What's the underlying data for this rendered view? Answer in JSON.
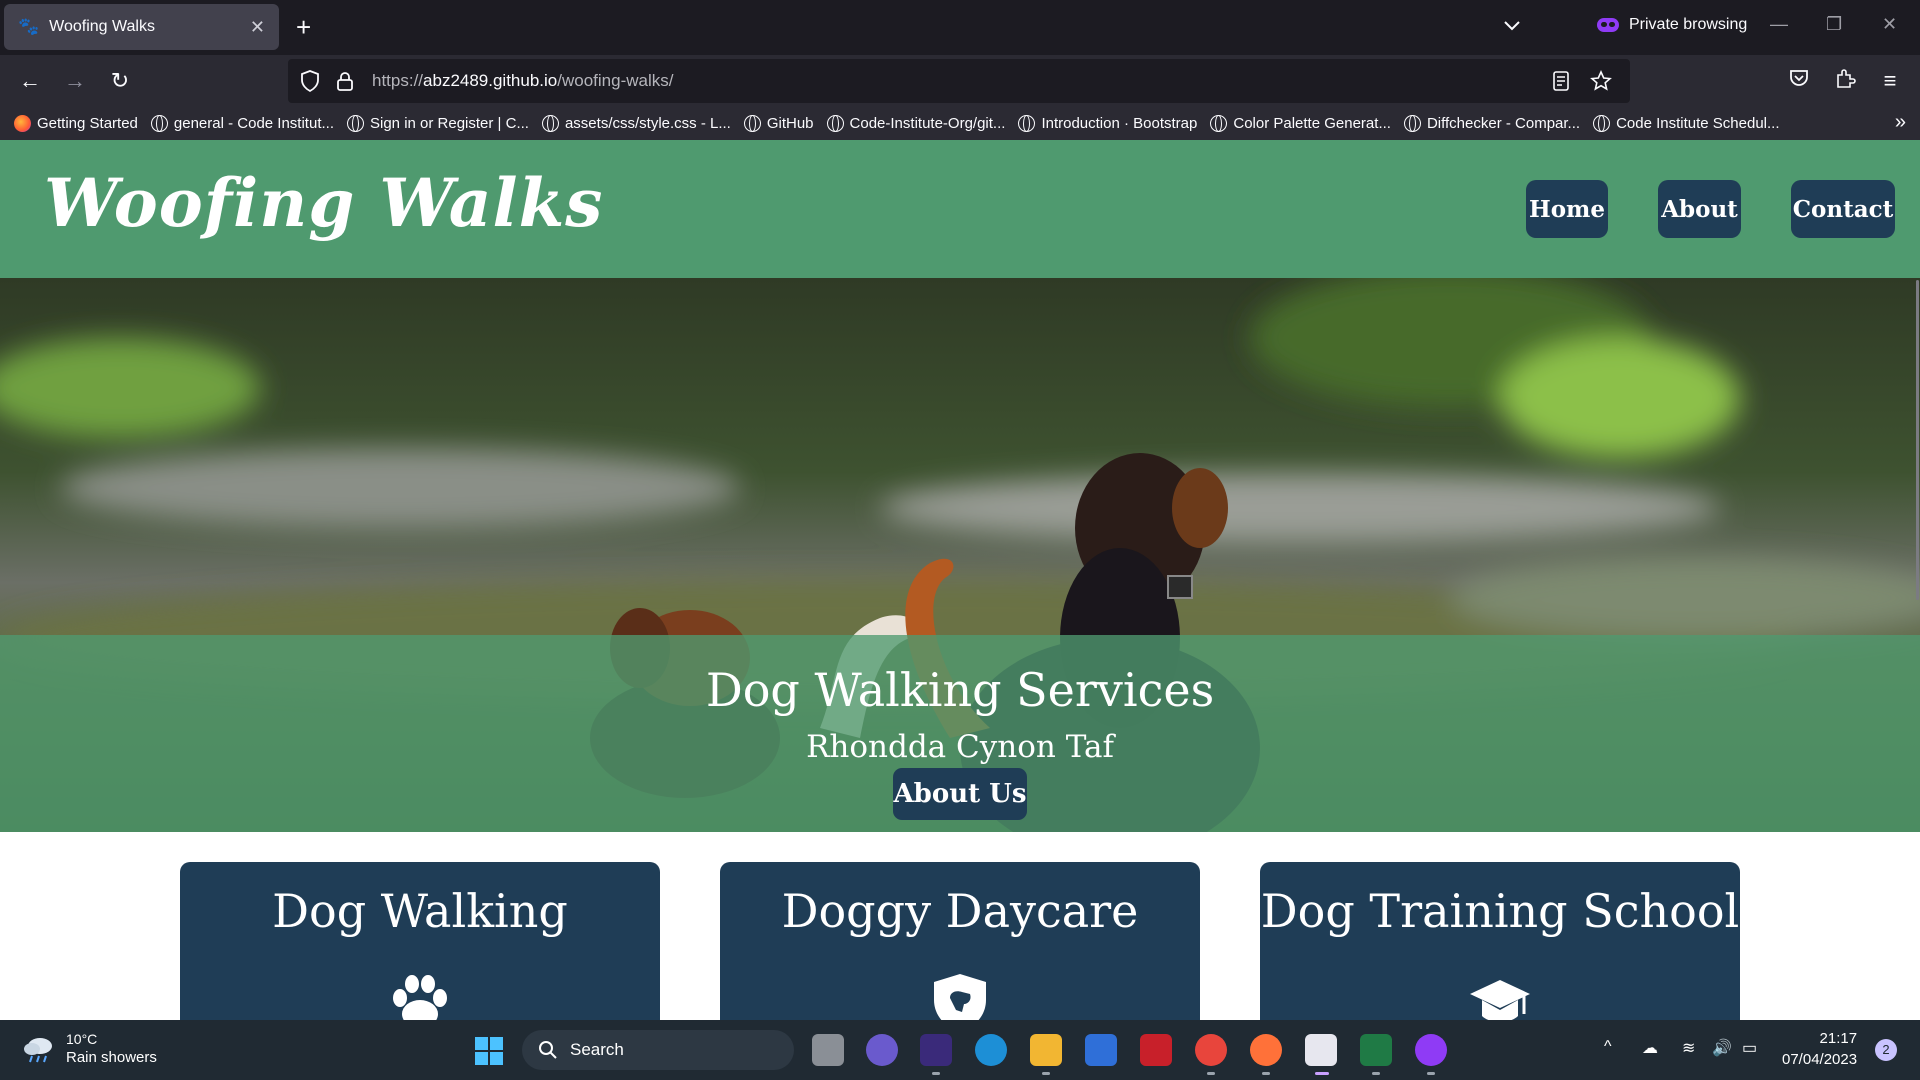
{
  "browser": {
    "tab_title": "Woofing Walks",
    "private_label": "Private browsing",
    "url_prefix": "https://",
    "url_host": "abz2489.github.io",
    "url_path": "/woofing-walks/",
    "bookmarks": [
      "Getting Started",
      "general - Code Institut...",
      "Sign in or Register | C...",
      "assets/css/style.css - L...",
      "GitHub",
      "Code-Institute-Org/git...",
      "Introduction · Bootstrap",
      "Color Palette Generat...",
      "Diffchecker - Compar...",
      "Code Institute Schedul..."
    ]
  },
  "site": {
    "logo": "Woofing Walks",
    "nav": [
      "Home",
      "About",
      "Contact"
    ],
    "hero": {
      "title": "Dog Walking Services",
      "subtitle": "Rhondda Cynon Taf",
      "button": "About Us"
    },
    "cards": [
      {
        "title": "Dog Walking",
        "icon": "paw-icon"
      },
      {
        "title": "Doggy Daycare",
        "icon": "dog-shield-icon"
      },
      {
        "title": "Dog Training School",
        "icon": "graduation-cap-icon"
      }
    ]
  },
  "taskbar": {
    "temperature": "10°C",
    "condition": "Rain showers",
    "search_label": "Search",
    "time": "21:17",
    "date": "07/04/2023",
    "notifications": "2"
  },
  "colors": {
    "brand_green": "#4f9a6f",
    "brand_navy": "#1f3d56"
  }
}
